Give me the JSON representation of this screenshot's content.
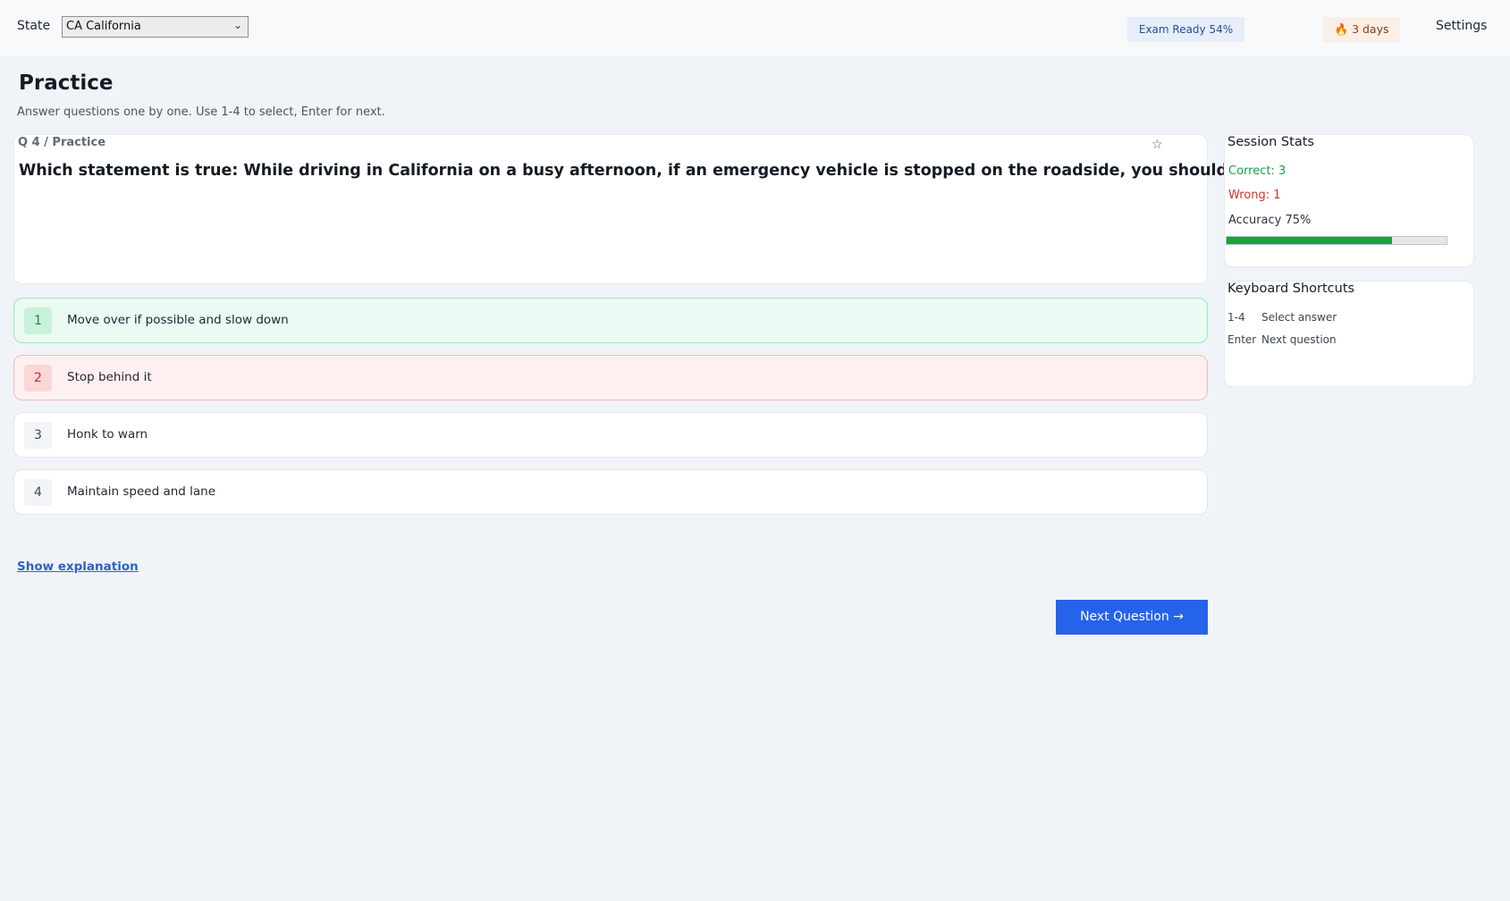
{
  "header": {
    "state_label": "State",
    "state_value": "CA  California",
    "exam_ready": "Exam Ready 54%",
    "streak_icon": "flame-icon",
    "streak_text": "3 days",
    "settings_label": "Settings"
  },
  "page": {
    "title": "Practice",
    "subtitle": "Answer questions one by one. Use 1-4 to select, Enter for next."
  },
  "question": {
    "meta": "Q 4 / Practice",
    "star_icon": "star-icon",
    "text": "Which statement is true: While driving in California on a busy afternoon, if an emergency vehicle is stopped on the roadside, you should:?",
    "options": [
      {
        "num": "1",
        "text": "Move over if possible and slow down",
        "state": "correct"
      },
      {
        "num": "2",
        "text": "Stop behind it",
        "state": "wrong"
      },
      {
        "num": "3",
        "text": "Honk to warn",
        "state": "neutral"
      },
      {
        "num": "4",
        "text": "Maintain speed and lane",
        "state": "neutral"
      }
    ]
  },
  "actions": {
    "explain_label": "Show explanation",
    "next_label": "Next Question →"
  },
  "stats": {
    "title": "Session Stats",
    "correct": "Correct: 3",
    "wrong": "Wrong: 1",
    "accuracy": "Accuracy 75%",
    "accuracy_value": 0.75
  },
  "shortcuts": {
    "title": "Keyboard Shortcuts",
    "items": [
      {
        "key": "1-4",
        "desc": "Select answer"
      },
      {
        "key": "Enter",
        "desc": "Next question"
      }
    ]
  },
  "colors": {
    "primary": "#2563eb",
    "correct": "#16a34a",
    "wrong": "#d32f2f",
    "background": "#f0f4f8"
  }
}
